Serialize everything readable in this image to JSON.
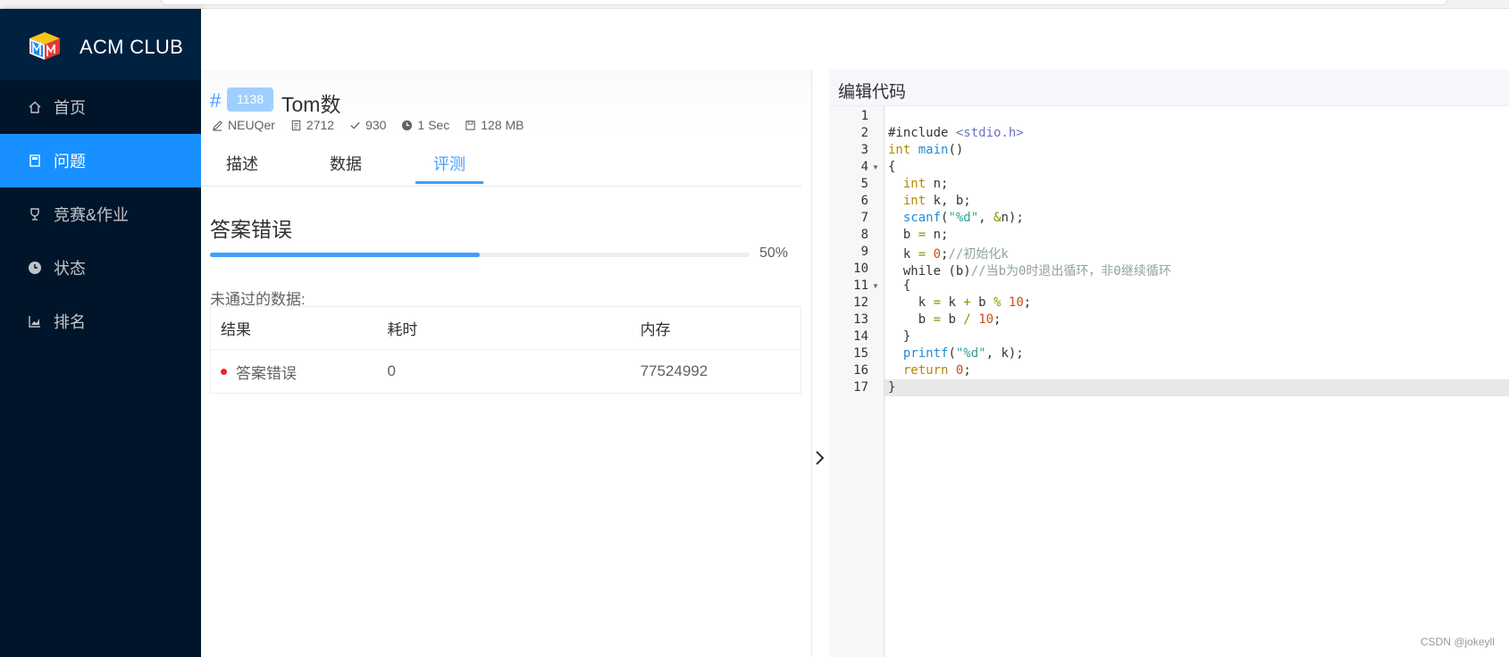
{
  "app": {
    "name": "ACM CLUB"
  },
  "sidebar": {
    "items": [
      {
        "label": "首页",
        "icon": "home-icon",
        "active": false
      },
      {
        "label": "问题",
        "icon": "book-icon",
        "active": true
      },
      {
        "label": "竞赛&作业",
        "icon": "trophy-icon",
        "active": false
      },
      {
        "label": "状态",
        "icon": "clock-icon",
        "active": false
      },
      {
        "label": "排名",
        "icon": "chart-icon",
        "active": false
      }
    ]
  },
  "problem": {
    "hash": "#",
    "id": "1138",
    "title": "Tom数",
    "author": "NEUQer",
    "submissions": "2712",
    "accepted": "930",
    "time_limit": "1 Sec",
    "memory_limit": "128 MB"
  },
  "tabs": [
    {
      "label": "描述",
      "active": false
    },
    {
      "label": "数据",
      "active": false
    },
    {
      "label": "评测",
      "active": true
    }
  ],
  "judge": {
    "verdict": "答案错误",
    "progress": 50,
    "progress_text": "50%",
    "failed_label": "未通过的数据:",
    "columns": [
      "结果",
      "耗时",
      "内存"
    ],
    "rows": [
      {
        "result": "答案错误",
        "time": "0",
        "memory": "77524992",
        "status_color": "#f5222d"
      }
    ]
  },
  "editor": {
    "title": "编辑代码",
    "active_line": 17,
    "lines": [
      {
        "n": "1",
        "fold": false
      },
      {
        "n": "2",
        "fold": false
      },
      {
        "n": "3",
        "fold": false
      },
      {
        "n": "4",
        "fold": true
      },
      {
        "n": "5",
        "fold": false
      },
      {
        "n": "6",
        "fold": false
      },
      {
        "n": "7",
        "fold": false
      },
      {
        "n": "8",
        "fold": false
      },
      {
        "n": "9",
        "fold": false
      },
      {
        "n": "10",
        "fold": false
      },
      {
        "n": "11",
        "fold": true
      },
      {
        "n": "12",
        "fold": false
      },
      {
        "n": "13",
        "fold": false
      },
      {
        "n": "14",
        "fold": false
      },
      {
        "n": "15",
        "fold": false
      },
      {
        "n": "16",
        "fold": false
      },
      {
        "n": "17",
        "fold": false
      }
    ],
    "code": [
      [],
      [
        [
          "",
          "#include "
        ],
        [
          "kw2",
          "<stdio.h>"
        ]
      ],
      [
        [
          "kw",
          "int"
        ],
        [
          "",
          " "
        ],
        [
          "fn",
          "main"
        ],
        [
          "",
          "()"
        ]
      ],
      [
        [
          "",
          "{"
        ]
      ],
      [
        [
          "",
          "  "
        ],
        [
          "kw",
          "int"
        ],
        [
          "",
          " n;"
        ]
      ],
      [
        [
          "",
          "  "
        ],
        [
          "kw",
          "int"
        ],
        [
          "",
          " k, b;"
        ]
      ],
      [
        [
          "",
          "  "
        ],
        [
          "fn",
          "scanf"
        ],
        [
          "",
          "("
        ],
        [
          "str",
          "\"%d\""
        ],
        [
          "",
          ", "
        ],
        [
          "op",
          "&"
        ],
        [
          "",
          "n);"
        ]
      ],
      [
        [
          "",
          "  b "
        ],
        [
          "op",
          "="
        ],
        [
          "",
          " n;"
        ]
      ],
      [
        [
          "",
          "  k "
        ],
        [
          "op",
          "="
        ],
        [
          "",
          " "
        ],
        [
          "num",
          "0"
        ],
        [
          "",
          ";"
        ],
        [
          "cm",
          "//初始化k"
        ]
      ],
      [
        [
          "",
          "  while (b)"
        ],
        [
          "cm",
          "//当b为0时退出循环，非0继续循环"
        ]
      ],
      [
        [
          "",
          "  {"
        ]
      ],
      [
        [
          "",
          "    k "
        ],
        [
          "op",
          "="
        ],
        [
          "",
          " k "
        ],
        [
          "op",
          "+"
        ],
        [
          "",
          " b "
        ],
        [
          "op",
          "%"
        ],
        [
          "",
          " "
        ],
        [
          "num",
          "10"
        ],
        [
          "",
          ";"
        ]
      ],
      [
        [
          "",
          "    b "
        ],
        [
          "op",
          "="
        ],
        [
          "",
          " b "
        ],
        [
          "op",
          "/"
        ],
        [
          "",
          " "
        ],
        [
          "num",
          "10"
        ],
        [
          "",
          ";"
        ]
      ],
      [
        [
          "",
          "  }"
        ]
      ],
      [
        [
          "",
          "  "
        ],
        [
          "fn",
          "printf"
        ],
        [
          "",
          "("
        ],
        [
          "str",
          "\"%d\""
        ],
        [
          "",
          ", k);"
        ]
      ],
      [
        [
          "",
          "  "
        ],
        [
          "kw",
          "return"
        ],
        [
          "",
          " "
        ],
        [
          "num",
          "0"
        ],
        [
          "",
          ";"
        ]
      ],
      [
        [
          "",
          "}"
        ]
      ]
    ]
  },
  "watermark": "CSDN @jokeyll"
}
